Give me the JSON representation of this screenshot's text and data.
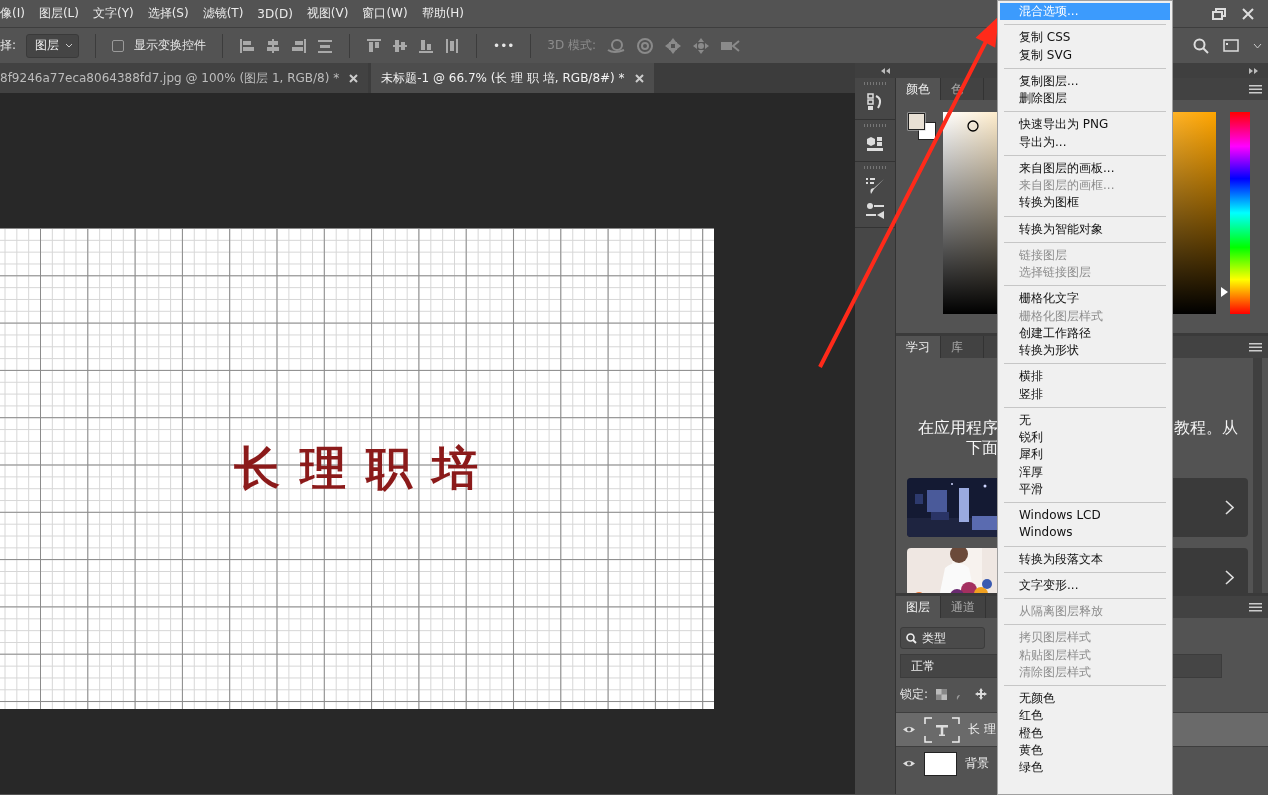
{
  "menu_bar": {
    "items": [
      "像(I)",
      "图层(L)",
      "文字(Y)",
      "选择(S)",
      "滤镜(T)",
      "3D(D)",
      "视图(V)",
      "窗口(W)",
      "帮助(H)"
    ]
  },
  "options_bar": {
    "label": "择:",
    "target": "图层",
    "transform_controls": {
      "label": "显示变换控件",
      "checked": false
    },
    "more": "•••",
    "mode_3d_label": "3D 模式:"
  },
  "doc_tabs": [
    {
      "title": "8f9246a77eca8064388fd7.jpg @ 100% (图层 1, RGB/8) *",
      "selected": false
    },
    {
      "title": "未标题-1 @ 66.7% (长 理 职 培, RGB/8#) *",
      "selected": true
    }
  ],
  "canvas": {
    "text": "长 理 职 培"
  },
  "color_panel": {
    "tabs": [
      {
        "label": "颜色",
        "selected": true
      },
      {
        "label": "色",
        "selected": false
      }
    ],
    "hue": {
      "level": 0.11
    }
  },
  "learn_panel": {
    "tabs": [
      {
        "label": "学习",
        "selected": true
      },
      {
        "label": "库",
        "selected": false
      }
    ],
    "text_left": [
      "在应用程序",
      "下面"
    ],
    "text_right": "教程。从",
    "cards": [
      {
        "kind": "picture"
      },
      {
        "kind": "picture"
      }
    ]
  },
  "layers_panel": {
    "tabs": [
      {
        "label": "图层",
        "selected": true
      },
      {
        "label": "通道",
        "selected": false
      }
    ],
    "filter": "类型",
    "blend_mode": "正常",
    "lock_label": "锁定:",
    "layers": [
      {
        "name": "长 理",
        "kind": "text",
        "visible": true,
        "selected": true
      },
      {
        "name": "背景",
        "visible": true,
        "selected": false
      }
    ]
  },
  "context_menu": {
    "groups": [
      {
        "items": [
          {
            "label": "混合选项...",
            "selected": true,
            "disabled": false
          }
        ]
      },
      {
        "items": [
          {
            "label": "复制 CSS",
            "selected": false,
            "disabled": false
          },
          {
            "label": "复制 SVG",
            "selected": false,
            "disabled": false
          }
        ]
      },
      {
        "items": [
          {
            "label": "复制图层...",
            "selected": false,
            "disabled": false
          },
          {
            "label": "删除图层",
            "selected": false,
            "disabled": false
          }
        ]
      },
      {
        "items": [
          {
            "label": "快速导出为 PNG",
            "selected": false,
            "disabled": false
          },
          {
            "label": "导出为...",
            "selected": false,
            "disabled": false
          }
        ]
      },
      {
        "items": [
          {
            "label": "来自图层的画板...",
            "selected": false,
            "disabled": false
          },
          {
            "label": "来自图层的画框...",
            "selected": false,
            "disabled": true
          },
          {
            "label": "转换为图框",
            "selected": false,
            "disabled": false
          }
        ]
      },
      {
        "items": [
          {
            "label": "转换为智能对象",
            "selected": false,
            "disabled": false
          }
        ]
      },
      {
        "items": [
          {
            "label": "链接图层",
            "selected": false,
            "disabled": true
          },
          {
            "label": "选择链接图层",
            "selected": false,
            "disabled": true
          }
        ]
      },
      {
        "items": [
          {
            "label": "栅格化文字",
            "selected": false,
            "disabled": false
          },
          {
            "label": "栅格化图层样式",
            "selected": false,
            "disabled": true
          },
          {
            "label": "创建工作路径",
            "selected": false,
            "disabled": false
          },
          {
            "label": "转换为形状",
            "selected": false,
            "disabled": false
          }
        ]
      },
      {
        "items": [
          {
            "label": "横排",
            "selected": false,
            "disabled": false
          },
          {
            "label": "竖排",
            "selected": false,
            "disabled": false
          }
        ]
      },
      {
        "items": [
          {
            "label": "无",
            "selected": false,
            "disabled": false
          },
          {
            "label": "锐利",
            "selected": false,
            "disabled": false
          },
          {
            "label": "犀利",
            "selected": false,
            "disabled": false
          },
          {
            "label": "浑厚",
            "selected": false,
            "disabled": false
          },
          {
            "label": "平滑",
            "selected": false,
            "disabled": false
          }
        ]
      },
      {
        "items": [
          {
            "label": "Windows LCD",
            "selected": false,
            "disabled": false
          },
          {
            "label": "Windows",
            "selected": false,
            "disabled": false
          }
        ]
      },
      {
        "items": [
          {
            "label": "转换为段落文本",
            "selected": false,
            "disabled": false
          }
        ]
      },
      {
        "items": [
          {
            "label": "文字变形...",
            "selected": false,
            "disabled": false
          }
        ]
      },
      {
        "items": [
          {
            "label": "从隔离图层释放",
            "selected": false,
            "disabled": true
          }
        ]
      },
      {
        "items": [
          {
            "label": "拷贝图层样式",
            "selected": false,
            "disabled": true
          },
          {
            "label": "粘贴图层样式",
            "selected": false,
            "disabled": true
          },
          {
            "label": "清除图层样式",
            "selected": false,
            "disabled": true
          }
        ]
      },
      {
        "items": [
          {
            "label": "无颜色",
            "selected": false,
            "disabled": false
          },
          {
            "label": "红色",
            "selected": false,
            "disabled": false
          },
          {
            "label": "橙色",
            "selected": false,
            "disabled": false
          },
          {
            "label": "黄色",
            "selected": false,
            "disabled": false
          },
          {
            "label": "绿色",
            "selected": false,
            "disabled": false
          }
        ]
      }
    ]
  }
}
